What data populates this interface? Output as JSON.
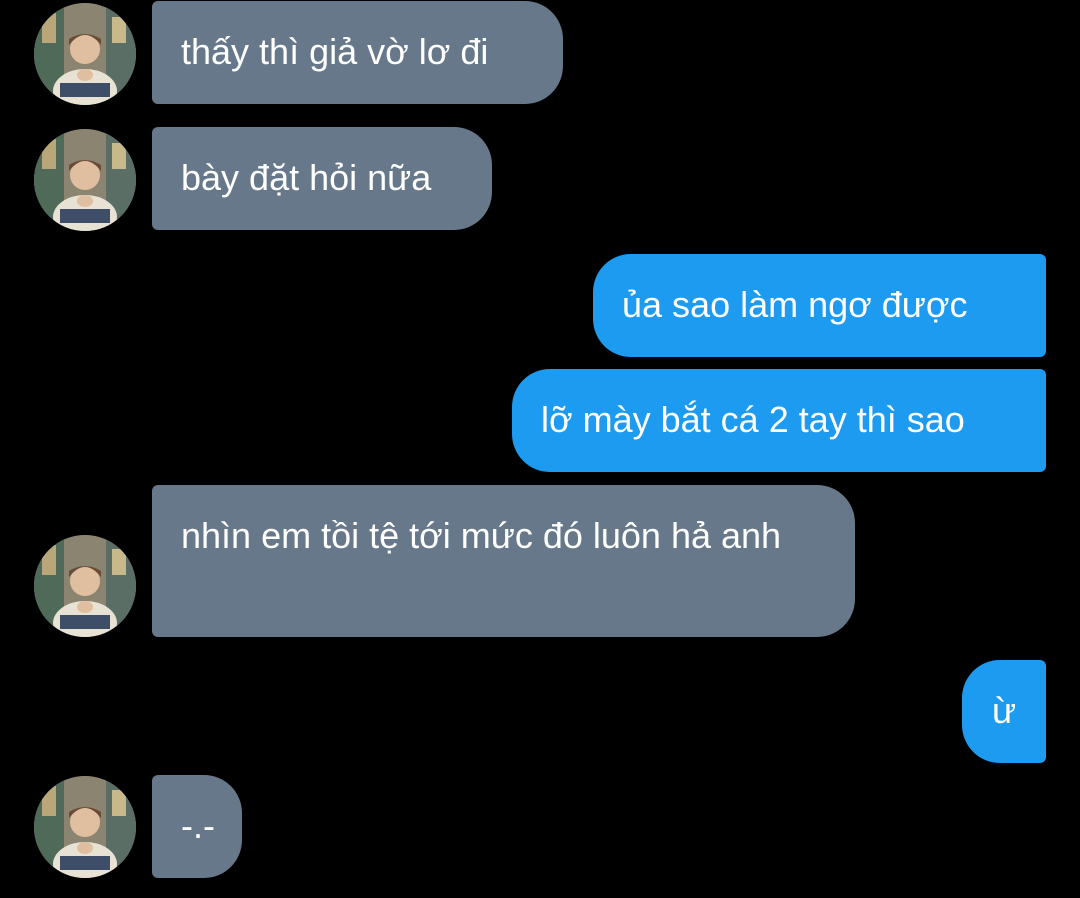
{
  "conversation": {
    "messages": [
      {
        "sender": "other",
        "text": "thấy thì giả vờ lơ đi",
        "show_avatar": true
      },
      {
        "sender": "other",
        "text": "bày đặt hỏi nữa",
        "show_avatar": true
      },
      {
        "sender": "me",
        "text": "ủa sao làm ngơ được"
      },
      {
        "sender": "me",
        "text": "lỡ mày bắt cá 2 tay thì sao"
      },
      {
        "sender": "other",
        "text": "nhìn em tồi tệ tới mức đó luôn hả anh",
        "show_avatar": true
      },
      {
        "sender": "me",
        "text": "ừ"
      },
      {
        "sender": "other",
        "text": "-.-",
        "show_avatar": true
      }
    ]
  },
  "colors": {
    "background": "#000000",
    "received_bubble": "#66788a",
    "sent_bubble": "#1d9bf0",
    "text": "#ffffff"
  },
  "icons": {
    "avatar": "profile-photo"
  }
}
